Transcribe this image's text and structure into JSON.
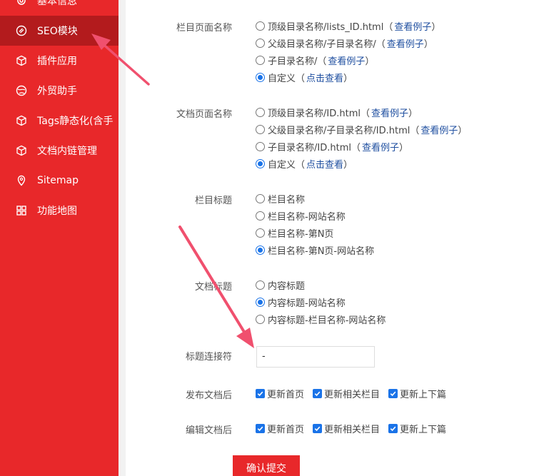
{
  "sidebar": {
    "items": [
      {
        "label": "基本信息",
        "icon": "gear-icon"
      },
      {
        "label": "SEO模块",
        "icon": "seo-icon",
        "active": true
      },
      {
        "label": "插件应用",
        "icon": "cube-icon"
      },
      {
        "label": "外贸助手",
        "icon": "globe-icon"
      },
      {
        "label": "Tags静态化(含手",
        "icon": "cube-icon"
      },
      {
        "label": "文档内链管理",
        "icon": "cube-icon"
      },
      {
        "label": "Sitemap",
        "icon": "map-pin-icon"
      },
      {
        "label": "功能地图",
        "icon": "grid-icon"
      }
    ]
  },
  "form": {
    "column_page_name": {
      "label": "栏目页面名称",
      "options": [
        {
          "text": "顶级目录名称/lists_ID.html",
          "link": "查看例子",
          "checked": false
        },
        {
          "text": "父级目录名称/子目录名称/",
          "link": "查看例子",
          "checked": false
        },
        {
          "text": "子目录名称/",
          "link": "查看例子",
          "checked": false
        },
        {
          "text": "自定义",
          "link": "点击查看",
          "checked": true
        }
      ]
    },
    "doc_page_name": {
      "label": "文档页面名称",
      "options": [
        {
          "text": "顶级目录名称/ID.html",
          "link": "查看例子",
          "checked": false
        },
        {
          "text": "父级目录名称/子目录名称/ID.html",
          "link": "查看例子",
          "checked": false
        },
        {
          "text": "子目录名称/ID.html",
          "link": "查看例子",
          "checked": false
        },
        {
          "text": "自定义",
          "link": "点击查看",
          "checked": true
        }
      ]
    },
    "column_title": {
      "label": "栏目标题",
      "options": [
        {
          "text": "栏目名称",
          "checked": false
        },
        {
          "text": "栏目名称-网站名称",
          "checked": false
        },
        {
          "text": "栏目名称-第N页",
          "checked": false
        },
        {
          "text": "栏目名称-第N页-网站名称",
          "checked": true
        }
      ]
    },
    "doc_title": {
      "label": "文档标题",
      "options": [
        {
          "text": "内容标题",
          "checked": false
        },
        {
          "text": "内容标题-网站名称",
          "checked": true
        },
        {
          "text": "内容标题-栏目名称-网站名称",
          "checked": false
        }
      ]
    },
    "title_separator": {
      "label": "标题连接符",
      "value": "-"
    },
    "after_publish": {
      "label": "发布文档后",
      "options": [
        {
          "text": "更新首页",
          "checked": true
        },
        {
          "text": "更新相关栏目",
          "checked": true
        },
        {
          "text": "更新上下篇",
          "checked": true
        }
      ]
    },
    "after_edit": {
      "label": "编辑文档后",
      "options": [
        {
          "text": "更新首页",
          "checked": true
        },
        {
          "text": "更新相关栏目",
          "checked": true
        },
        {
          "text": "更新上下篇",
          "checked": true
        }
      ]
    },
    "submit_label": "确认提交"
  },
  "colors": {
    "sidebar_bg": "#e8282a",
    "sidebar_active": "#b31b1d",
    "accent_blue": "#1a73e8",
    "link": "#1f4fa0",
    "annotation_arrow": "#f0506e"
  }
}
